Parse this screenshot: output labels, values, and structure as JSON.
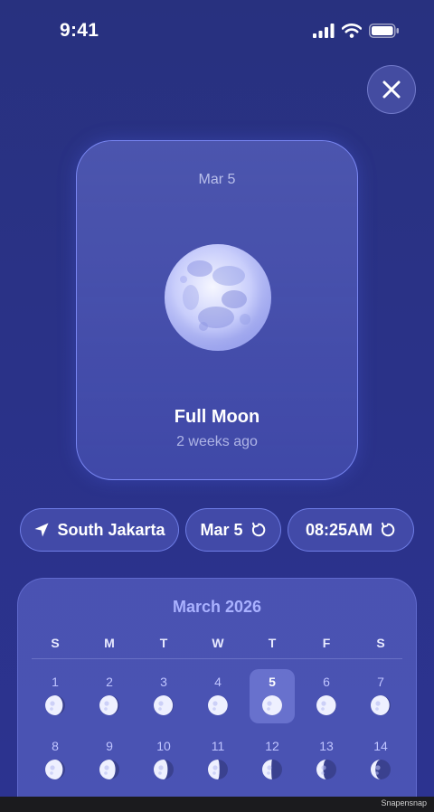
{
  "status_bar": {
    "time": "9:41"
  },
  "card": {
    "date": "Mar 5",
    "phase_name": "Full Moon",
    "relative_time": "2 weeks ago"
  },
  "chips": {
    "location": "South Jakarta",
    "date": "Mar 5",
    "time": "08:25AM"
  },
  "calendar": {
    "month_label": "March 2026",
    "weekdays": [
      "S",
      "M",
      "T",
      "W",
      "T",
      "F",
      "S"
    ],
    "days": [
      {
        "num": "1",
        "phase": 0.88
      },
      {
        "num": "2",
        "phase": 0.92
      },
      {
        "num": "3",
        "phase": 0.96
      },
      {
        "num": "4",
        "phase": 0.99
      },
      {
        "num": "5",
        "phase": 1.0,
        "selected": true
      },
      {
        "num": "6",
        "phase": 0.98
      },
      {
        "num": "7",
        "phase": 0.94
      },
      {
        "num": "8",
        "phase": 0.88
      },
      {
        "num": "9",
        "phase": 0.8
      },
      {
        "num": "10",
        "phase": 0.7
      },
      {
        "num": "11",
        "phase": 0.58
      },
      {
        "num": "12",
        "phase": 0.46
      },
      {
        "num": "13",
        "phase": 0.34
      },
      {
        "num": "14",
        "phase": 0.24
      }
    ]
  },
  "footer": {
    "watermark": "Snapensnap"
  },
  "colors": {
    "background": "#2a3287",
    "card_border": "#8291ff",
    "month_label": "#a9b1ff",
    "moon_light": "#eef0ff",
    "moon_shadow": "#3a418f"
  }
}
